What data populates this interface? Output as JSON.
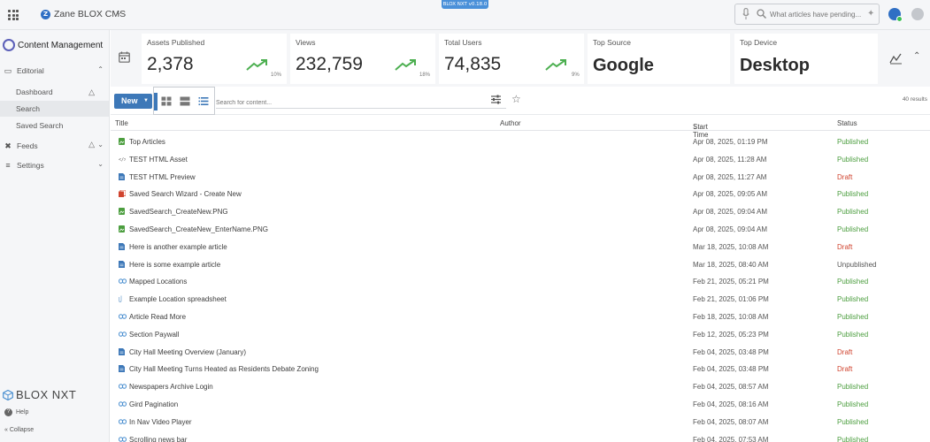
{
  "topbar": {
    "site_initial": "Z",
    "site_name": "Zane BLOX CMS",
    "version_badge": "BLOX NXT v0.18.0",
    "ai_search_placeholder": "What articles have pending..."
  },
  "sidebar": {
    "brand": "Content Management",
    "groups": [
      {
        "label": "Editorial",
        "icon": "folder-icon"
      },
      {
        "label": "Feeds",
        "icon": "feeds-icon"
      },
      {
        "label": "Settings",
        "icon": "settings-icon"
      }
    ],
    "editorial_items": [
      {
        "label": "Dashboard",
        "active": false
      },
      {
        "label": "Search",
        "active": true
      },
      {
        "label": "Saved Search",
        "active": false
      }
    ],
    "logo_text": "BLOX NXT",
    "help_label": "Help",
    "collapse_label": "Collapse"
  },
  "stats": [
    {
      "label": "Assets Published",
      "value": "2,378",
      "pct": "10%"
    },
    {
      "label": "Views",
      "value": "232,759",
      "pct": "18%"
    },
    {
      "label": "Total Users",
      "value": "74,835",
      "pct": "9%"
    },
    {
      "label": "Top Source",
      "value": "Google"
    },
    {
      "label": "Top Device",
      "value": "Desktop"
    }
  ],
  "toolbar": {
    "new_label": "New",
    "search_placeholder": "Search for content...",
    "results": "40 results"
  },
  "columns": {
    "title": "Title",
    "author": "Author",
    "start_time": "Start Time",
    "status": "Status"
  },
  "rows": [
    {
      "type": "image",
      "title": "Top Articles",
      "start": "Apr 08, 2025, 01:19 PM",
      "status": "Published"
    },
    {
      "type": "html",
      "title": "TEST HTML Asset",
      "start": "Apr 08, 2025, 11:28 AM",
      "status": "Published"
    },
    {
      "type": "article",
      "title": "TEST HTML Preview",
      "start": "Apr 08, 2025, 11:27 AM",
      "status": "Draft"
    },
    {
      "type": "collection",
      "title": "Saved Search Wizard - Create New",
      "start": "Apr 08, 2025, 09:05 AM",
      "status": "Published"
    },
    {
      "type": "image",
      "title": "SavedSearch_CreateNew.PNG",
      "start": "Apr 08, 2025, 09:04 AM",
      "status": "Published"
    },
    {
      "type": "image",
      "title": "SavedSearch_CreateNew_EnterName.PNG",
      "start": "Apr 08, 2025, 09:04 AM",
      "status": "Published"
    },
    {
      "type": "article",
      "title": "Here is another example article",
      "start": "Mar 18, 2025, 10:08 AM",
      "status": "Draft"
    },
    {
      "type": "article",
      "title": "Here is some example article",
      "start": "Mar 18, 2025, 08:40 AM",
      "status": "Unpublished"
    },
    {
      "type": "link",
      "title": "Mapped Locations",
      "start": "Feb 21, 2025, 05:21 PM",
      "status": "Published"
    },
    {
      "type": "file",
      "title": "Example Location spreadsheet",
      "start": "Feb 21, 2025, 01:06 PM",
      "status": "Published"
    },
    {
      "type": "link",
      "title": "Article Read More",
      "start": "Feb 18, 2025, 10:08 AM",
      "status": "Published"
    },
    {
      "type": "link",
      "title": "Section Paywall",
      "start": "Feb 12, 2025, 05:23 PM",
      "status": "Published"
    },
    {
      "type": "article",
      "title": "City Hall Meeting Overview (January)",
      "start": "Feb 04, 2025, 03:48 PM",
      "status": "Draft"
    },
    {
      "type": "article",
      "title": "City Hall Meeting Turns Heated as Residents Debate Zoning",
      "start": "Feb 04, 2025, 03:48 PM",
      "status": "Draft"
    },
    {
      "type": "link",
      "title": "Newspapers Archive Login",
      "start": "Feb 04, 2025, 08:57 AM",
      "status": "Published"
    },
    {
      "type": "link",
      "title": "Gird Pagination",
      "start": "Feb 04, 2025, 08:16 AM",
      "status": "Published"
    },
    {
      "type": "link",
      "title": "In Nav Video Player",
      "start": "Feb 04, 2025, 08:07 AM",
      "status": "Published"
    },
    {
      "type": "link",
      "title": "Scrolling news bar",
      "start": "Feb 04, 2025, 07:53 AM",
      "status": "Published"
    }
  ],
  "colors": {
    "accent": "#3d78b8",
    "published": "#4c9e3f",
    "draft": "#d0442f",
    "trend": "#4caf50"
  }
}
